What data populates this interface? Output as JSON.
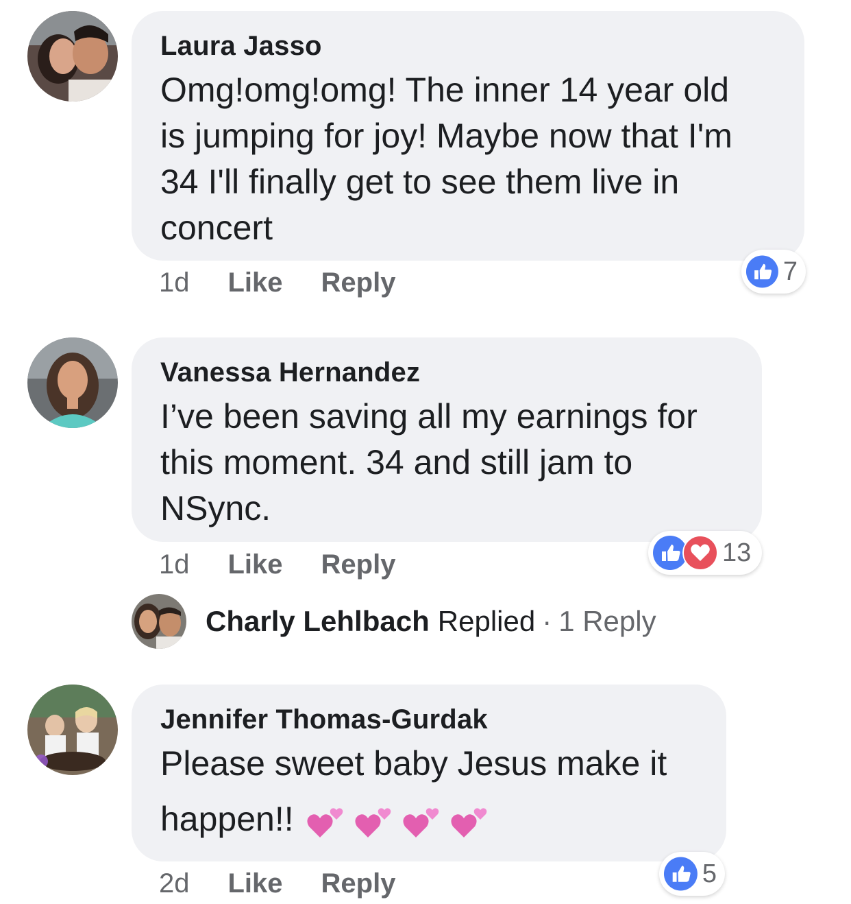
{
  "comments": [
    {
      "author": "Laura Jasso",
      "lines": [
        "Omg!omg!omg! The inner 14 year old",
        "is jumping for joy! Maybe now that I'm",
        "34 I'll finally get to see them live in",
        "concert"
      ],
      "time": "1d",
      "like_label": "Like",
      "reply_label": "Reply",
      "reaction_count": "7",
      "reactions": [
        "like-icon"
      ]
    },
    {
      "author": "Vanessa Hernandez",
      "lines": [
        "I’ve been saving all my earnings for",
        "this moment. 34 and still jam to",
        "NSync."
      ],
      "time": "1d",
      "like_label": "Like",
      "reply_label": "Reply",
      "reaction_count": "13",
      "reactions": [
        "like-icon",
        "love-icon"
      ]
    },
    {
      "author": "Jennifer Thomas-Gurdak",
      "lines": [
        "Please sweet baby Jesus make it",
        "happen!!"
      ],
      "time": "2d",
      "like_label": "Like",
      "reply_label": "Reply",
      "reaction_count": "5",
      "reactions": [
        "like-icon"
      ],
      "emoji": "two-hearts-emoji x4"
    }
  ],
  "reply_preview": {
    "name": "Charly Lehlbach",
    "action": "Replied",
    "separator": "·",
    "count": "1 Reply"
  },
  "colors": {
    "bubble": "#f0f1f4",
    "like_blue": "#4a7cf6",
    "love_red": "#e8505b",
    "meta_gray": "#65676b",
    "heart_pink": "#e35fb0"
  }
}
